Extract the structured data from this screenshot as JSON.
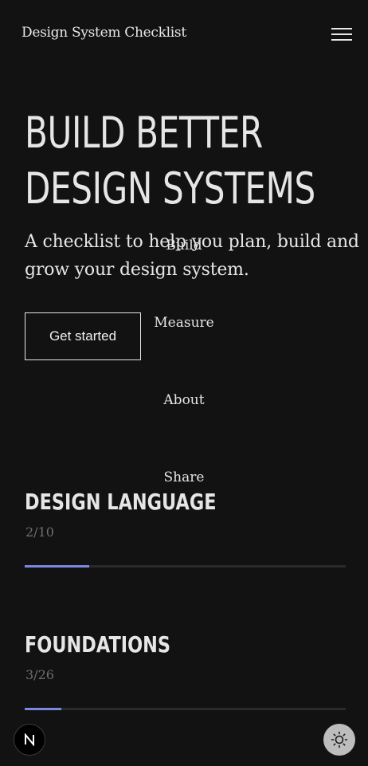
{
  "header": {
    "title": "Design System Checklist",
    "menu_icon": "hamburger-menu-icon"
  },
  "hero": {
    "title_line1": "BUILD BETTER",
    "title_line2": "DESIGN SYSTEMS",
    "subtitle": "A checklist to help you plan, build and grow your design system.",
    "cta_label": "Get started"
  },
  "nav": {
    "items": [
      "Build",
      "Measure",
      "About",
      "Share"
    ]
  },
  "sections": [
    {
      "title": "DESIGN LANGUAGE",
      "count": "2/10",
      "progress": 0.2
    },
    {
      "title": "FOUNDATIONS",
      "count": "3/26",
      "progress": 0.115
    }
  ],
  "footer": {
    "badge_icon": "nextjs-logo-icon",
    "badge_letter": "N",
    "theme_icon": "sun-icon"
  },
  "colors": {
    "background": "#121212",
    "text": "#e6e6e6",
    "accent": "#7b86e0",
    "muted": "#6e6e6e"
  }
}
